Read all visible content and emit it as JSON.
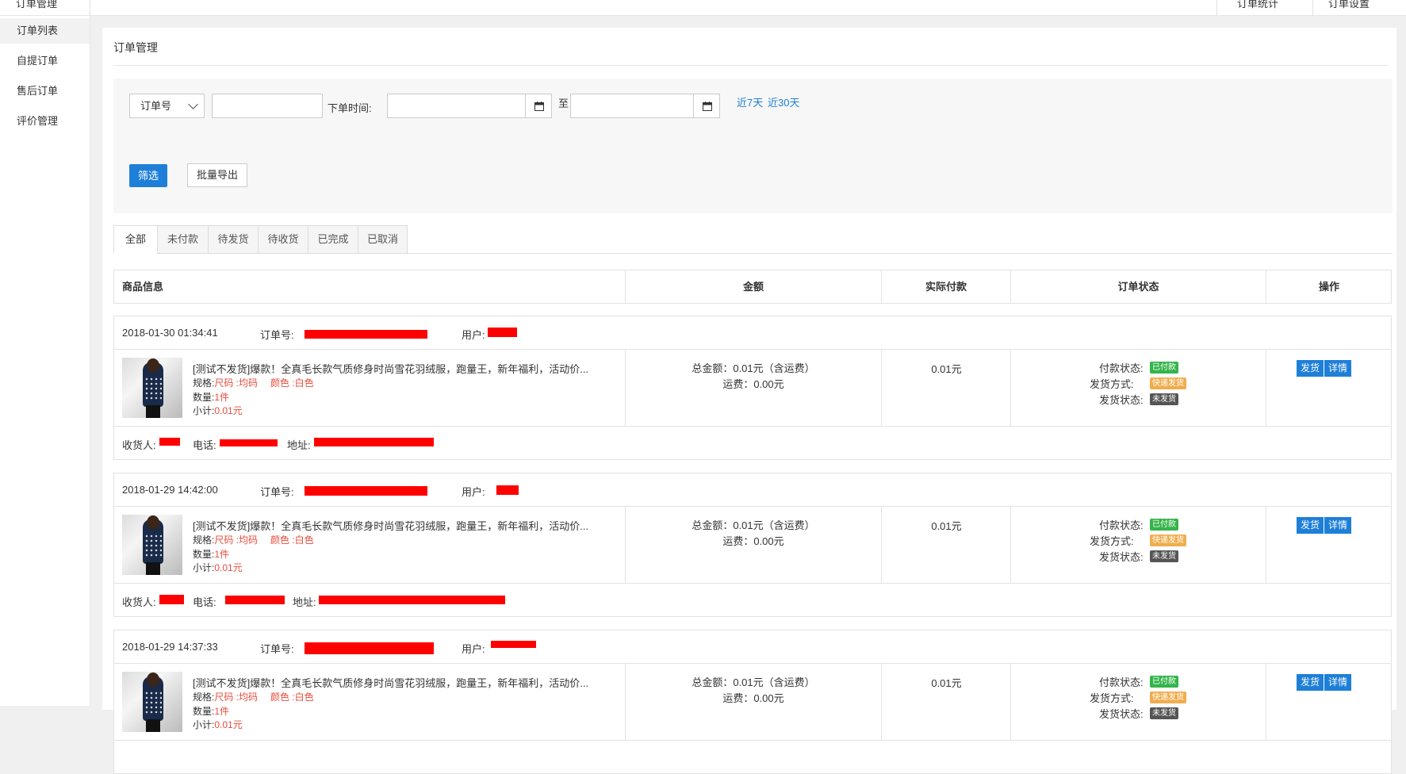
{
  "topbar": {
    "left_cut": "订单管理",
    "right_cut_1": "订单统计",
    "right_cut_2": "订单设置"
  },
  "sidebar": {
    "items": [
      {
        "label": "订单列表"
      },
      {
        "label": "自提订单"
      },
      {
        "label": "售后订单"
      },
      {
        "label": "评价管理"
      }
    ]
  },
  "page": {
    "title": "订单管理"
  },
  "filter": {
    "select_value": "订单号",
    "search_value": "",
    "time_label": "下单时间:",
    "date_from": "",
    "to_label": "至",
    "date_to": "",
    "quick_7": "近7天",
    "quick_30": "近30天",
    "filter_button": "筛选",
    "export_button": "批量导出"
  },
  "tabs": [
    {
      "label": "全部",
      "active": true
    },
    {
      "label": "未付款"
    },
    {
      "label": "待发货"
    },
    {
      "label": "待收货"
    },
    {
      "label": "已完成"
    },
    {
      "label": "已取消"
    }
  ],
  "table": {
    "headers": [
      "商品信息",
      "金额",
      "实际付款",
      "订单状态",
      "操作"
    ]
  },
  "labels": {
    "order_no": "订单号:",
    "user": "用户:",
    "spec": "规格:",
    "qty": "数量:",
    "subtotal": "小计:",
    "pay_status": "付款状态:",
    "ship_method": "发货方式:",
    "ship_status": "发货状态:",
    "receiver": "收货人:",
    "phone": "电话:",
    "address": "地址:",
    "ship_btn": "发货",
    "detail_btn": "详情"
  },
  "orders": [
    {
      "time": "2018-01-30 01:34:41",
      "product_name": "[测试不发货]爆款！全真毛长款气质修身时尚雪花羽绒服，跑量王，新年福利，活动价...",
      "spec_size": "尺码 :均码",
      "spec_color": "颜色 :白色",
      "qty": "1件",
      "subtotal": "0.01元",
      "total": "总金额：0.01元（含运费）",
      "freight": "运费：0.00元",
      "paid": "0.01元",
      "pay_badge": "已付款",
      "ship_badge": "快递发货",
      "ship_status_badge": "未发货"
    },
    {
      "time": "2018-01-29 14:42:00",
      "product_name": "[测试不发货]爆款！全真毛长款气质修身时尚雪花羽绒服，跑量王，新年福利，活动价...",
      "spec_size": "尺码 :均码",
      "spec_color": "颜色 :白色",
      "qty": "1件",
      "subtotal": "0.01元",
      "total": "总金额：0.01元（含运费）",
      "freight": "运费：0.00元",
      "paid": "0.01元",
      "pay_badge": "已付款",
      "ship_badge": "快递发货",
      "ship_status_badge": "未发货"
    },
    {
      "time": "2018-01-29 14:37:33",
      "product_name": "[测试不发货]爆款！全真毛长款气质修身时尚雪花羽绒服，跑量王，新年福利，活动价...",
      "spec_size": "尺码 :均码",
      "spec_color": "颜色 :白色",
      "qty": "1件",
      "subtotal": "0.01元",
      "total": "总金额：0.01元（含运费）",
      "freight": "运费：0.00元",
      "paid": "0.01元",
      "pay_badge": "已付款",
      "ship_badge": "快递发货",
      "ship_status_badge": "未发货"
    }
  ],
  "colors": {
    "primary": "#1e7fd8",
    "price_red": "#e84c3d",
    "badge_green": "#34b44a",
    "badge_orange": "#f0ad4e",
    "badge_gray": "#555555",
    "redaction": "#ff0000"
  }
}
